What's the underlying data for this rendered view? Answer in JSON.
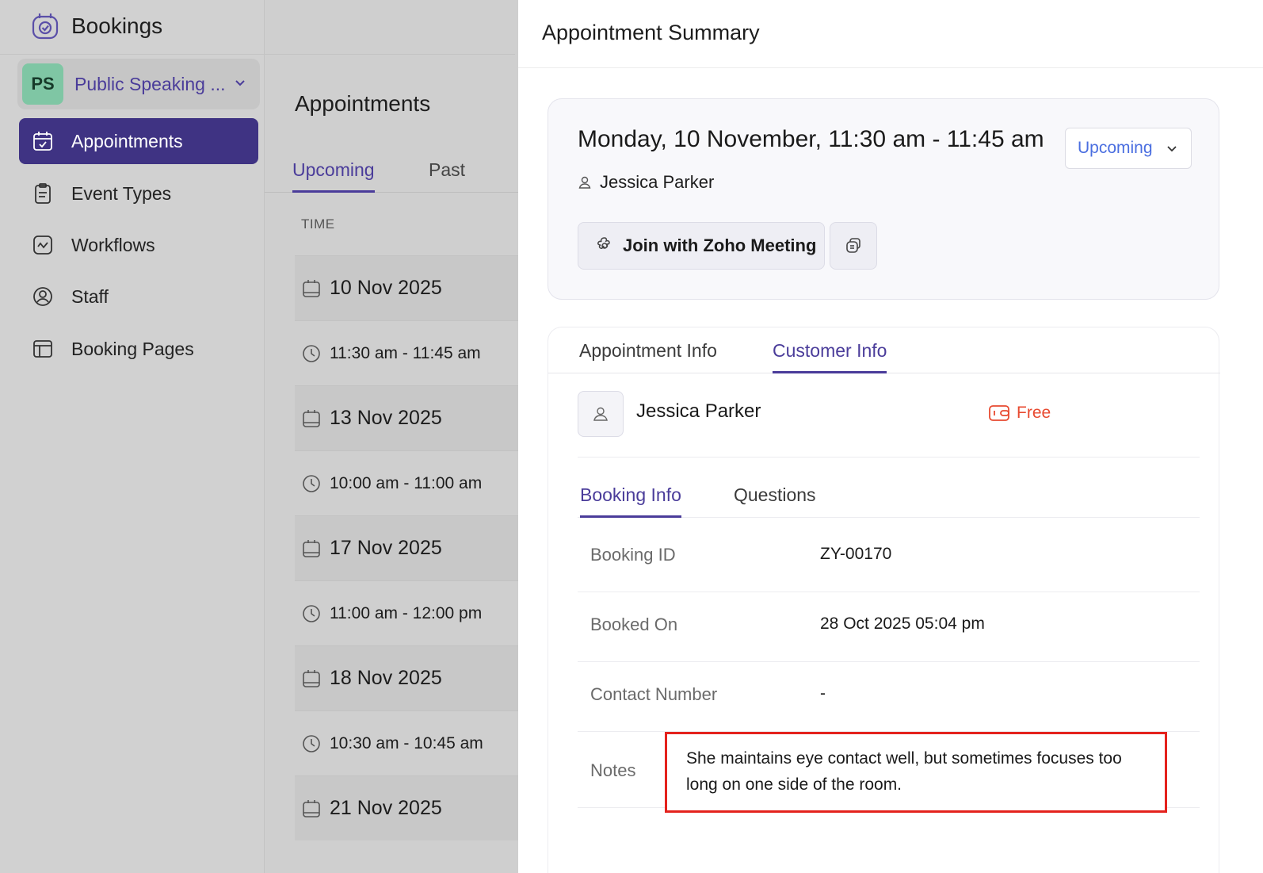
{
  "app": {
    "title": "Bookings"
  },
  "workspace": {
    "initials": "PS",
    "name": "Public Speaking ..."
  },
  "sidebar": {
    "items": [
      {
        "label": "Appointments",
        "icon": "calendar-check-icon",
        "active": true
      },
      {
        "label": "Event Types",
        "icon": "clipboard-icon"
      },
      {
        "label": "Workflows",
        "icon": "workflow-icon"
      },
      {
        "label": "Staff",
        "icon": "user-circle-icon"
      },
      {
        "label": "Booking Pages",
        "icon": "layout-icon"
      }
    ]
  },
  "list": {
    "title": "Appointments",
    "tabs": [
      {
        "label": "Upcoming",
        "active": true
      },
      {
        "label": "Past"
      }
    ],
    "column_header": "TIME",
    "rows": [
      {
        "kind": "date",
        "text": "10 Nov 2025"
      },
      {
        "kind": "time",
        "text": "11:30 am - 11:45 am"
      },
      {
        "kind": "date",
        "text": "13 Nov 2025"
      },
      {
        "kind": "time",
        "text": "10:00 am - 11:00 am"
      },
      {
        "kind": "date",
        "text": "17 Nov 2025"
      },
      {
        "kind": "time",
        "text": "11:00 am - 12:00 pm"
      },
      {
        "kind": "date",
        "text": "18 Nov 2025"
      },
      {
        "kind": "time",
        "text": "10:30 am - 10:45 am"
      },
      {
        "kind": "date",
        "text": "21 Nov 2025"
      }
    ]
  },
  "panel": {
    "title": "Appointment Summary",
    "summary": {
      "when": "Monday, 10 November, 11:30 am - 11:45 am",
      "status": "Upcoming",
      "attendee": "Jessica Parker",
      "join_label": "Join with Zoho Meeting"
    },
    "tabs": [
      {
        "label": "Appointment Info"
      },
      {
        "label": "Customer Info",
        "active": true
      }
    ],
    "customer": {
      "name": "Jessica Parker",
      "plan": "Free"
    },
    "sub_tabs": [
      {
        "label": "Booking Info",
        "active": true
      },
      {
        "label": "Questions"
      }
    ],
    "fields": [
      {
        "key": "Booking ID",
        "value": "ZY-00170"
      },
      {
        "key": "Booked On",
        "value": "28 Oct 2025 05:04 pm"
      },
      {
        "key": "Contact Number",
        "value": "-"
      }
    ],
    "notes": {
      "key": "Notes",
      "value": "She maintains eye contact well, but sometimes focuses too long on one side of the room."
    }
  },
  "colors": {
    "accent": "#3f3383",
    "accent_text": "#4a3c9a",
    "status_blue": "#4a6ee0",
    "plan_red": "#e84a30",
    "highlight_border": "#e4221d",
    "avatar_green": "#7fc6a4"
  }
}
